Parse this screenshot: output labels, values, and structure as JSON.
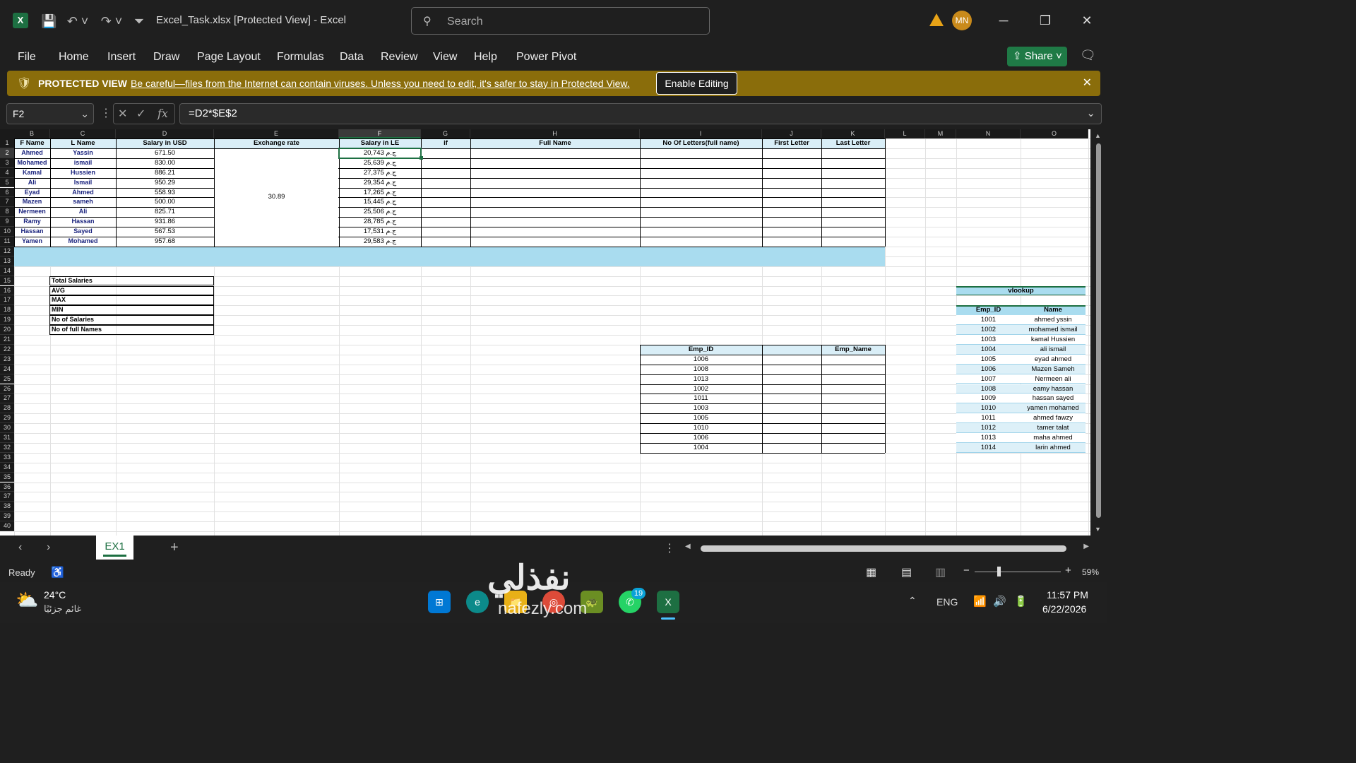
{
  "window": {
    "title": "Excel_Task.xlsx  [Protected View]  -  Excel",
    "search_placeholder": "Search",
    "user_initials": "MN"
  },
  "ribbon_tabs": [
    "File",
    "Home",
    "Insert",
    "Draw",
    "Page Layout",
    "Formulas",
    "Data",
    "Review",
    "View",
    "Help",
    "Power Pivot"
  ],
  "share_label": "Share",
  "protected_view": {
    "label": "PROTECTED VIEW",
    "message": "Be careful—files from the Internet can contain viruses. Unless you need to edit, it's safer to stay in Protected View.",
    "enable_button": "Enable Editing"
  },
  "formula_bar": {
    "name_box": "F2",
    "formula": "=D2*$E$2",
    "fx": "fx"
  },
  "columns": [
    "B",
    "C",
    "D",
    "E",
    "F",
    "G",
    "H",
    "I",
    "J",
    "K",
    "L",
    "M",
    "N",
    "O"
  ],
  "headers": {
    "f_name": "F Name",
    "l_name": "L Name",
    "salary_usd": "Salary in USD",
    "exchange_rate": "Exchange rate",
    "salary_le": "Salary in LE",
    "if": "if",
    "full_name": "Full Name",
    "no_letters": "No Of Letters(full name)",
    "first_letter": "First Letter",
    "last_letter": "Last Letter"
  },
  "exchange_rate_value": "30.89",
  "employees": [
    {
      "f": "Ahmed",
      "l": "Yassin",
      "usd": "671.50",
      "le": "20,743 ج.م"
    },
    {
      "f": "Mohamed",
      "l": "ismail",
      "usd": "830.00",
      "le": "25,639 ج.م"
    },
    {
      "f": "Kamal",
      "l": "Hussien",
      "usd": "886.21",
      "le": "27,375 ج.م"
    },
    {
      "f": "Ali",
      "l": "Ismail",
      "usd": "950.29",
      "le": "29,354 ج.م"
    },
    {
      "f": "Eyad",
      "l": "Ahmed",
      "usd": "558.93",
      "le": "17,265 ج.م"
    },
    {
      "f": "Mazen",
      "l": "sameh",
      "usd": "500.00",
      "le": "15,445 ج.م"
    },
    {
      "f": "Nermeen",
      "l": "Ali",
      "usd": "825.71",
      "le": "25,506 ج.م"
    },
    {
      "f": "Ramy",
      "l": "Hassan",
      "usd": "931.86",
      "le": "28,785 ج.م"
    },
    {
      "f": "Hassan",
      "l": "Sayed",
      "usd": "567.53",
      "le": "17,531 ج.م"
    },
    {
      "f": "Yamen",
      "l": "Mohamed",
      "usd": "957.68",
      "le": "29,583 ج.م"
    }
  ],
  "summary_labels": [
    "Total  Salaries",
    "AVG",
    "MAX",
    "MIN",
    "No of Salaries",
    "No of full Names"
  ],
  "lookup_table": {
    "emp_id_header": "Emp_ID",
    "emp_name_header": "Emp_Name",
    "ids": [
      "1006",
      "1008",
      "1013",
      "1002",
      "1011",
      "1003",
      "1005",
      "1010",
      "1006",
      "1004"
    ]
  },
  "vlookup": {
    "title": "vlookup",
    "id_header": "Emp_ID",
    "name_header": "Name",
    "rows": [
      [
        "1001",
        "ahmed yssin"
      ],
      [
        "1002",
        "mohamed ismail"
      ],
      [
        "1003",
        "kamal Hussien"
      ],
      [
        "1004",
        "ali ismail"
      ],
      [
        "1005",
        "eyad ahmed"
      ],
      [
        "1006",
        "Mazen Sameh"
      ],
      [
        "1007",
        "Nermeen ali"
      ],
      [
        "1008",
        "eamy hassan"
      ],
      [
        "1009",
        "hassan sayed"
      ],
      [
        "1010",
        "yamen mohamed"
      ],
      [
        "1011",
        "ahmed fawzy"
      ],
      [
        "1012",
        "tamer talat"
      ],
      [
        "1013",
        "maha ahmed"
      ],
      [
        "1014",
        "larin ahmed"
      ]
    ]
  },
  "sheet_tab": "EX1",
  "status": {
    "ready": "Ready",
    "zoom": "59%"
  },
  "taskbar": {
    "temp": "24°C",
    "weather": "غائم جزئيًا",
    "lang": "ENG",
    "time": "11:57 PM",
    "date": "6/22/2026",
    "badge": "19"
  },
  "watermark": {
    "arabic": "نفذلي",
    "latin": "nafezly.com"
  }
}
